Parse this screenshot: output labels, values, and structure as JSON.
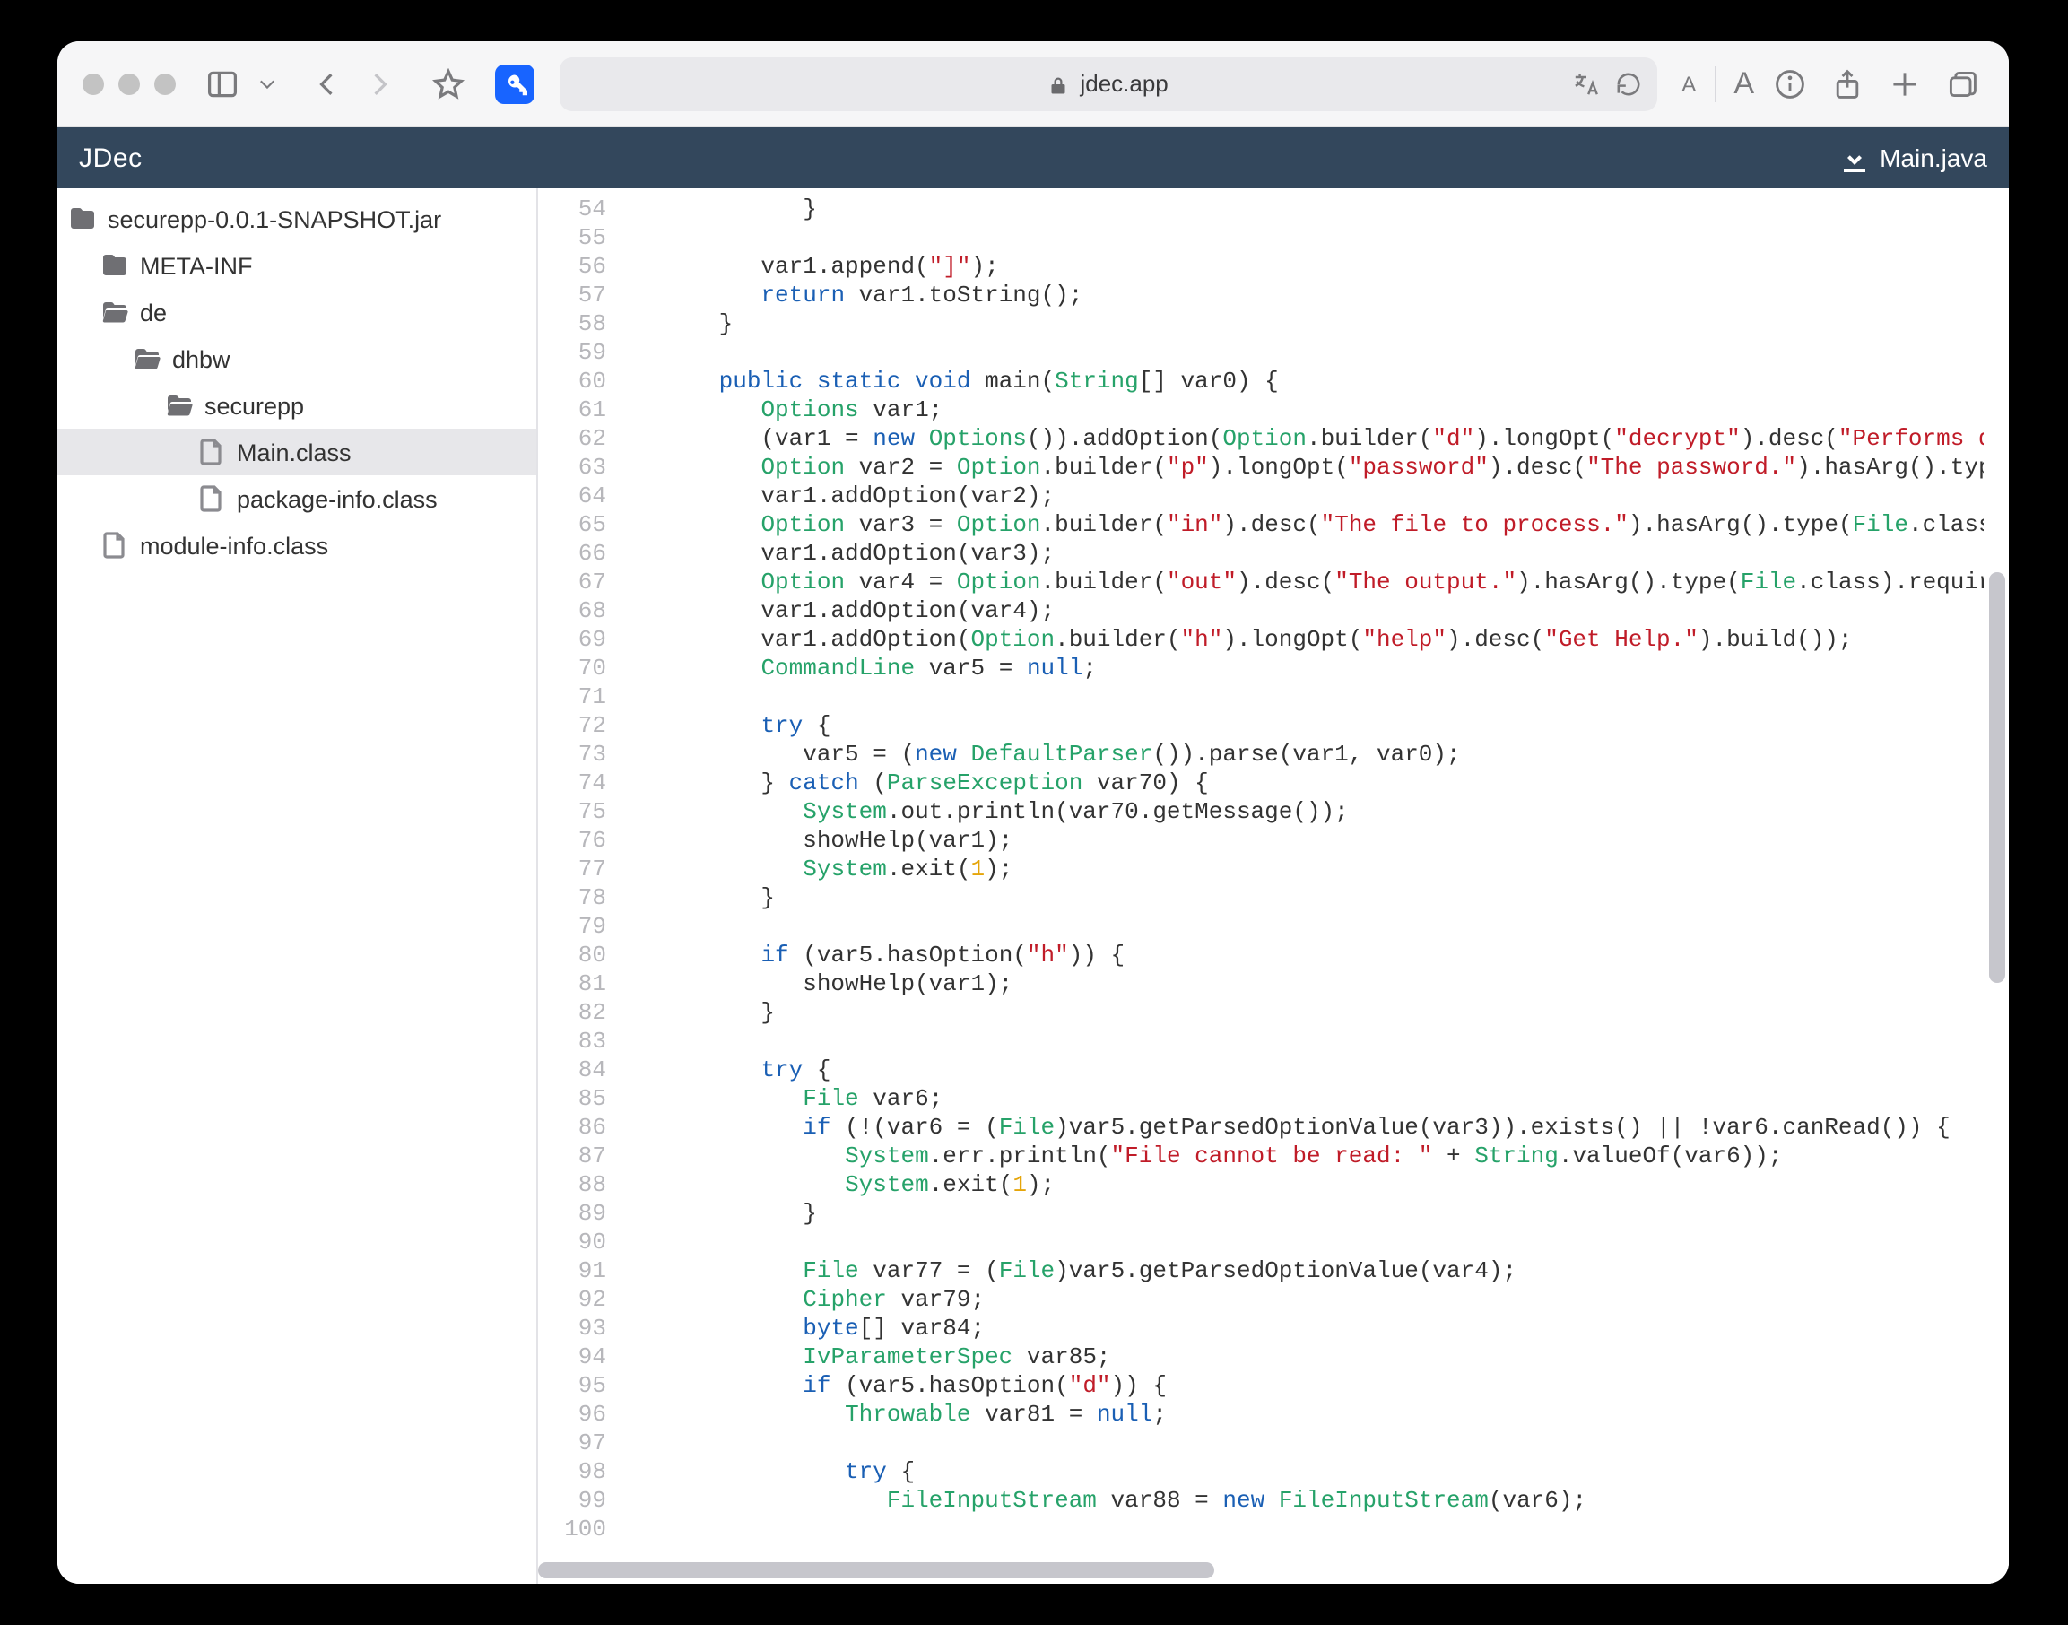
{
  "browser": {
    "url_label": "jdec.app",
    "reader_small": "A",
    "reader_large": "A"
  },
  "app": {
    "brand": "JDec",
    "crumb": "Main.java"
  },
  "sidebar": {
    "items": [
      {
        "depth": 0,
        "kind": "folder",
        "label": "securepp-0.0.1-SNAPSHOT.jar"
      },
      {
        "depth": 1,
        "kind": "folder",
        "label": "META-INF"
      },
      {
        "depth": 1,
        "kind": "folder-open",
        "label": "de"
      },
      {
        "depth": 2,
        "kind": "folder-open",
        "label": "dhbw"
      },
      {
        "depth": 3,
        "kind": "folder-open",
        "label": "securepp"
      },
      {
        "depth": 4,
        "kind": "file",
        "label": "Main.class",
        "selected": true
      },
      {
        "depth": 4,
        "kind": "file",
        "label": "package-info.class"
      },
      {
        "depth": 1,
        "kind": "file",
        "label": "module-info.class"
      }
    ]
  },
  "editor": {
    "first_line_number": 54,
    "lines": [
      [
        [
          "",
          "            }"
        ]
      ],
      [
        [
          "",
          ""
        ]
      ],
      [
        [
          "",
          "         var1.append("
        ],
        [
          "st",
          "\"]\""
        ],
        [
          "",
          ");"
        ]
      ],
      [
        [
          "",
          "         "
        ],
        [
          "kw",
          "return"
        ],
        [
          "",
          " var1.toString();"
        ]
      ],
      [
        [
          "",
          "      }"
        ]
      ],
      [
        [
          "",
          ""
        ]
      ],
      [
        [
          "",
          "      "
        ],
        [
          "kw",
          "public static void"
        ],
        [
          "",
          " main("
        ],
        [
          "ty",
          "String"
        ],
        [
          "",
          "[] var0) {"
        ]
      ],
      [
        [
          "",
          "         "
        ],
        [
          "ty",
          "Options"
        ],
        [
          "",
          " var1;"
        ]
      ],
      [
        [
          "",
          "         (var1 = "
        ],
        [
          "kw",
          "new"
        ],
        [
          "",
          " "
        ],
        [
          "ty",
          "Options"
        ],
        [
          "",
          "()).addOption("
        ],
        [
          "ty",
          "Option"
        ],
        [
          "",
          ".builder("
        ],
        [
          "st",
          "\"d\""
        ],
        [
          "",
          ").longOpt("
        ],
        [
          "st",
          "\"decrypt\""
        ],
        [
          "",
          ").desc("
        ],
        [
          "st",
          "\"Performs dec"
        ]
      ],
      [
        [
          "",
          "         "
        ],
        [
          "ty",
          "Option"
        ],
        [
          "",
          " var2 = "
        ],
        [
          "ty",
          "Option"
        ],
        [
          "",
          ".builder("
        ],
        [
          "st",
          "\"p\""
        ],
        [
          "",
          ").longOpt("
        ],
        [
          "st",
          "\"password\""
        ],
        [
          "",
          ").desc("
        ],
        [
          "st",
          "\"The password.\""
        ],
        [
          "",
          ").hasArg().type("
        ]
      ],
      [
        [
          "",
          "         var1.addOption(var2);"
        ]
      ],
      [
        [
          "",
          "         "
        ],
        [
          "ty",
          "Option"
        ],
        [
          "",
          " var3 = "
        ],
        [
          "ty",
          "Option"
        ],
        [
          "",
          ".builder("
        ],
        [
          "st",
          "\"in\""
        ],
        [
          "",
          ").desc("
        ],
        [
          "st",
          "\"The file to process.\""
        ],
        [
          "",
          ").hasArg().type("
        ],
        [
          "ty",
          "File"
        ],
        [
          "",
          ".class)."
        ]
      ],
      [
        [
          "",
          "         var1.addOption(var3);"
        ]
      ],
      [
        [
          "",
          "         "
        ],
        [
          "ty",
          "Option"
        ],
        [
          "",
          " var4 = "
        ],
        [
          "ty",
          "Option"
        ],
        [
          "",
          ".builder("
        ],
        [
          "st",
          "\"out\""
        ],
        [
          "",
          ").desc("
        ],
        [
          "st",
          "\"The output.\""
        ],
        [
          "",
          ").hasArg().type("
        ],
        [
          "ty",
          "File"
        ],
        [
          "",
          ".class).required"
        ]
      ],
      [
        [
          "",
          "         var1.addOption(var4);"
        ]
      ],
      [
        [
          "",
          "         var1.addOption("
        ],
        [
          "ty",
          "Option"
        ],
        [
          "",
          ".builder("
        ],
        [
          "st",
          "\"h\""
        ],
        [
          "",
          ").longOpt("
        ],
        [
          "st",
          "\"help\""
        ],
        [
          "",
          ").desc("
        ],
        [
          "st",
          "\"Get Help.\""
        ],
        [
          "",
          ").build());"
        ]
      ],
      [
        [
          "",
          "         "
        ],
        [
          "ty",
          "CommandLine"
        ],
        [
          "",
          " var5 = "
        ],
        [
          "kw",
          "null"
        ],
        [
          "",
          ";"
        ]
      ],
      [
        [
          "",
          ""
        ]
      ],
      [
        [
          "",
          "         "
        ],
        [
          "kw",
          "try"
        ],
        [
          "",
          " {"
        ]
      ],
      [
        [
          "",
          "            var5 = ("
        ],
        [
          "kw",
          "new"
        ],
        [
          "",
          " "
        ],
        [
          "ty",
          "DefaultParser"
        ],
        [
          "",
          "()).parse(var1, var0);"
        ]
      ],
      [
        [
          "",
          "         } "
        ],
        [
          "kw",
          "catch"
        ],
        [
          "",
          " ("
        ],
        [
          "ty",
          "ParseException"
        ],
        [
          "",
          " var70) {"
        ]
      ],
      [
        [
          "",
          "            "
        ],
        [
          "ty",
          "System"
        ],
        [
          "",
          ".out.println(var70.getMessage());"
        ]
      ],
      [
        [
          "",
          "            showHelp(var1);"
        ]
      ],
      [
        [
          "",
          "            "
        ],
        [
          "ty",
          "System"
        ],
        [
          "",
          ".exit("
        ],
        [
          "nu",
          "1"
        ],
        [
          "",
          ");"
        ]
      ],
      [
        [
          "",
          "         }"
        ]
      ],
      [
        [
          "",
          ""
        ]
      ],
      [
        [
          "",
          "         "
        ],
        [
          "kw",
          "if"
        ],
        [
          "",
          " (var5.hasOption("
        ],
        [
          "st",
          "\"h\""
        ],
        [
          "",
          ")) {"
        ]
      ],
      [
        [
          "",
          "            showHelp(var1);"
        ]
      ],
      [
        [
          "",
          "         }"
        ]
      ],
      [
        [
          "",
          ""
        ]
      ],
      [
        [
          "",
          "         "
        ],
        [
          "kw",
          "try"
        ],
        [
          "",
          " {"
        ]
      ],
      [
        [
          "",
          "            "
        ],
        [
          "ty",
          "File"
        ],
        [
          "",
          " var6;"
        ]
      ],
      [
        [
          "",
          "            "
        ],
        [
          "kw",
          "if"
        ],
        [
          "",
          " (!(var6 = ("
        ],
        [
          "ty",
          "File"
        ],
        [
          "",
          ")var5.getParsedOptionValue(var3)).exists() || !var6.canRead()) {"
        ]
      ],
      [
        [
          "",
          "               "
        ],
        [
          "ty",
          "System"
        ],
        [
          "",
          ".err.println("
        ],
        [
          "st",
          "\"File cannot be read: \""
        ],
        [
          "",
          " + "
        ],
        [
          "ty",
          "String"
        ],
        [
          "",
          ".valueOf(var6));"
        ]
      ],
      [
        [
          "",
          "               "
        ],
        [
          "ty",
          "System"
        ],
        [
          "",
          ".exit("
        ],
        [
          "nu",
          "1"
        ],
        [
          "",
          ");"
        ]
      ],
      [
        [
          "",
          "            }"
        ]
      ],
      [
        [
          "",
          ""
        ]
      ],
      [
        [
          "",
          "            "
        ],
        [
          "ty",
          "File"
        ],
        [
          "",
          " var77 = ("
        ],
        [
          "ty",
          "File"
        ],
        [
          "",
          ")var5.getParsedOptionValue(var4);"
        ]
      ],
      [
        [
          "",
          "            "
        ],
        [
          "ty",
          "Cipher"
        ],
        [
          "",
          " var79;"
        ]
      ],
      [
        [
          "",
          "            "
        ],
        [
          "kw",
          "byte"
        ],
        [
          "",
          "[] var84;"
        ]
      ],
      [
        [
          "",
          "            "
        ],
        [
          "ty",
          "IvParameterSpec"
        ],
        [
          "",
          " var85;"
        ]
      ],
      [
        [
          "",
          "            "
        ],
        [
          "kw",
          "if"
        ],
        [
          "",
          " (var5.hasOption("
        ],
        [
          "st",
          "\"d\""
        ],
        [
          "",
          ")) {"
        ]
      ],
      [
        [
          "",
          "               "
        ],
        [
          "ty",
          "Throwable"
        ],
        [
          "",
          " var81 = "
        ],
        [
          "kw",
          "null"
        ],
        [
          "",
          ";"
        ]
      ],
      [
        [
          "",
          ""
        ]
      ],
      [
        [
          "",
          "               "
        ],
        [
          "kw",
          "try"
        ],
        [
          "",
          " {"
        ]
      ],
      [
        [
          "",
          "                  "
        ],
        [
          "ty",
          "FileInputStream"
        ],
        [
          "",
          " var88 = "
        ],
        [
          "kw",
          "new"
        ],
        [
          "",
          " "
        ],
        [
          "ty",
          "FileInputStream"
        ],
        [
          "",
          "(var6);"
        ]
      ],
      [
        [
          "",
          ""
        ]
      ]
    ]
  }
}
